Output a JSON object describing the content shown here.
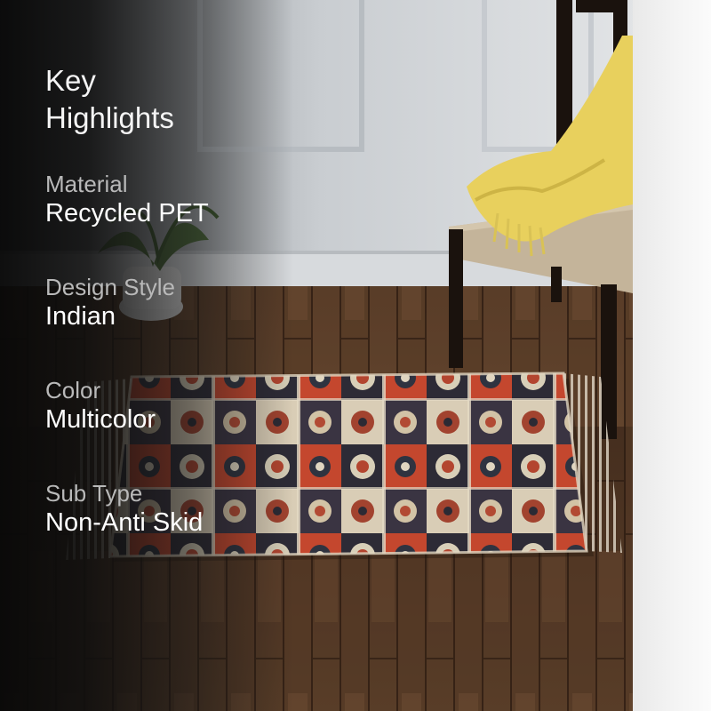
{
  "panel": {
    "title_line1": "Key",
    "title_line2": "Highlights"
  },
  "highlights": [
    {
      "label": "Material",
      "value": "Recycled PET"
    },
    {
      "label": "Design Style",
      "value": "Indian"
    },
    {
      "label": "Color",
      "value": "Multicolor"
    },
    {
      "label": "Sub Type",
      "value": "Non-Anti Skid"
    }
  ],
  "photo": {
    "subject": "rug-on-wooden-floor",
    "colors": {
      "wall": "#d6d9dc",
      "floor": "#5a3c26",
      "rug_red": "#c0432a",
      "rug_dark": "#2a2a36",
      "rug_cream": "#e6dcc7",
      "throw": "#e9d15d",
      "chair": "#1c1410"
    }
  }
}
